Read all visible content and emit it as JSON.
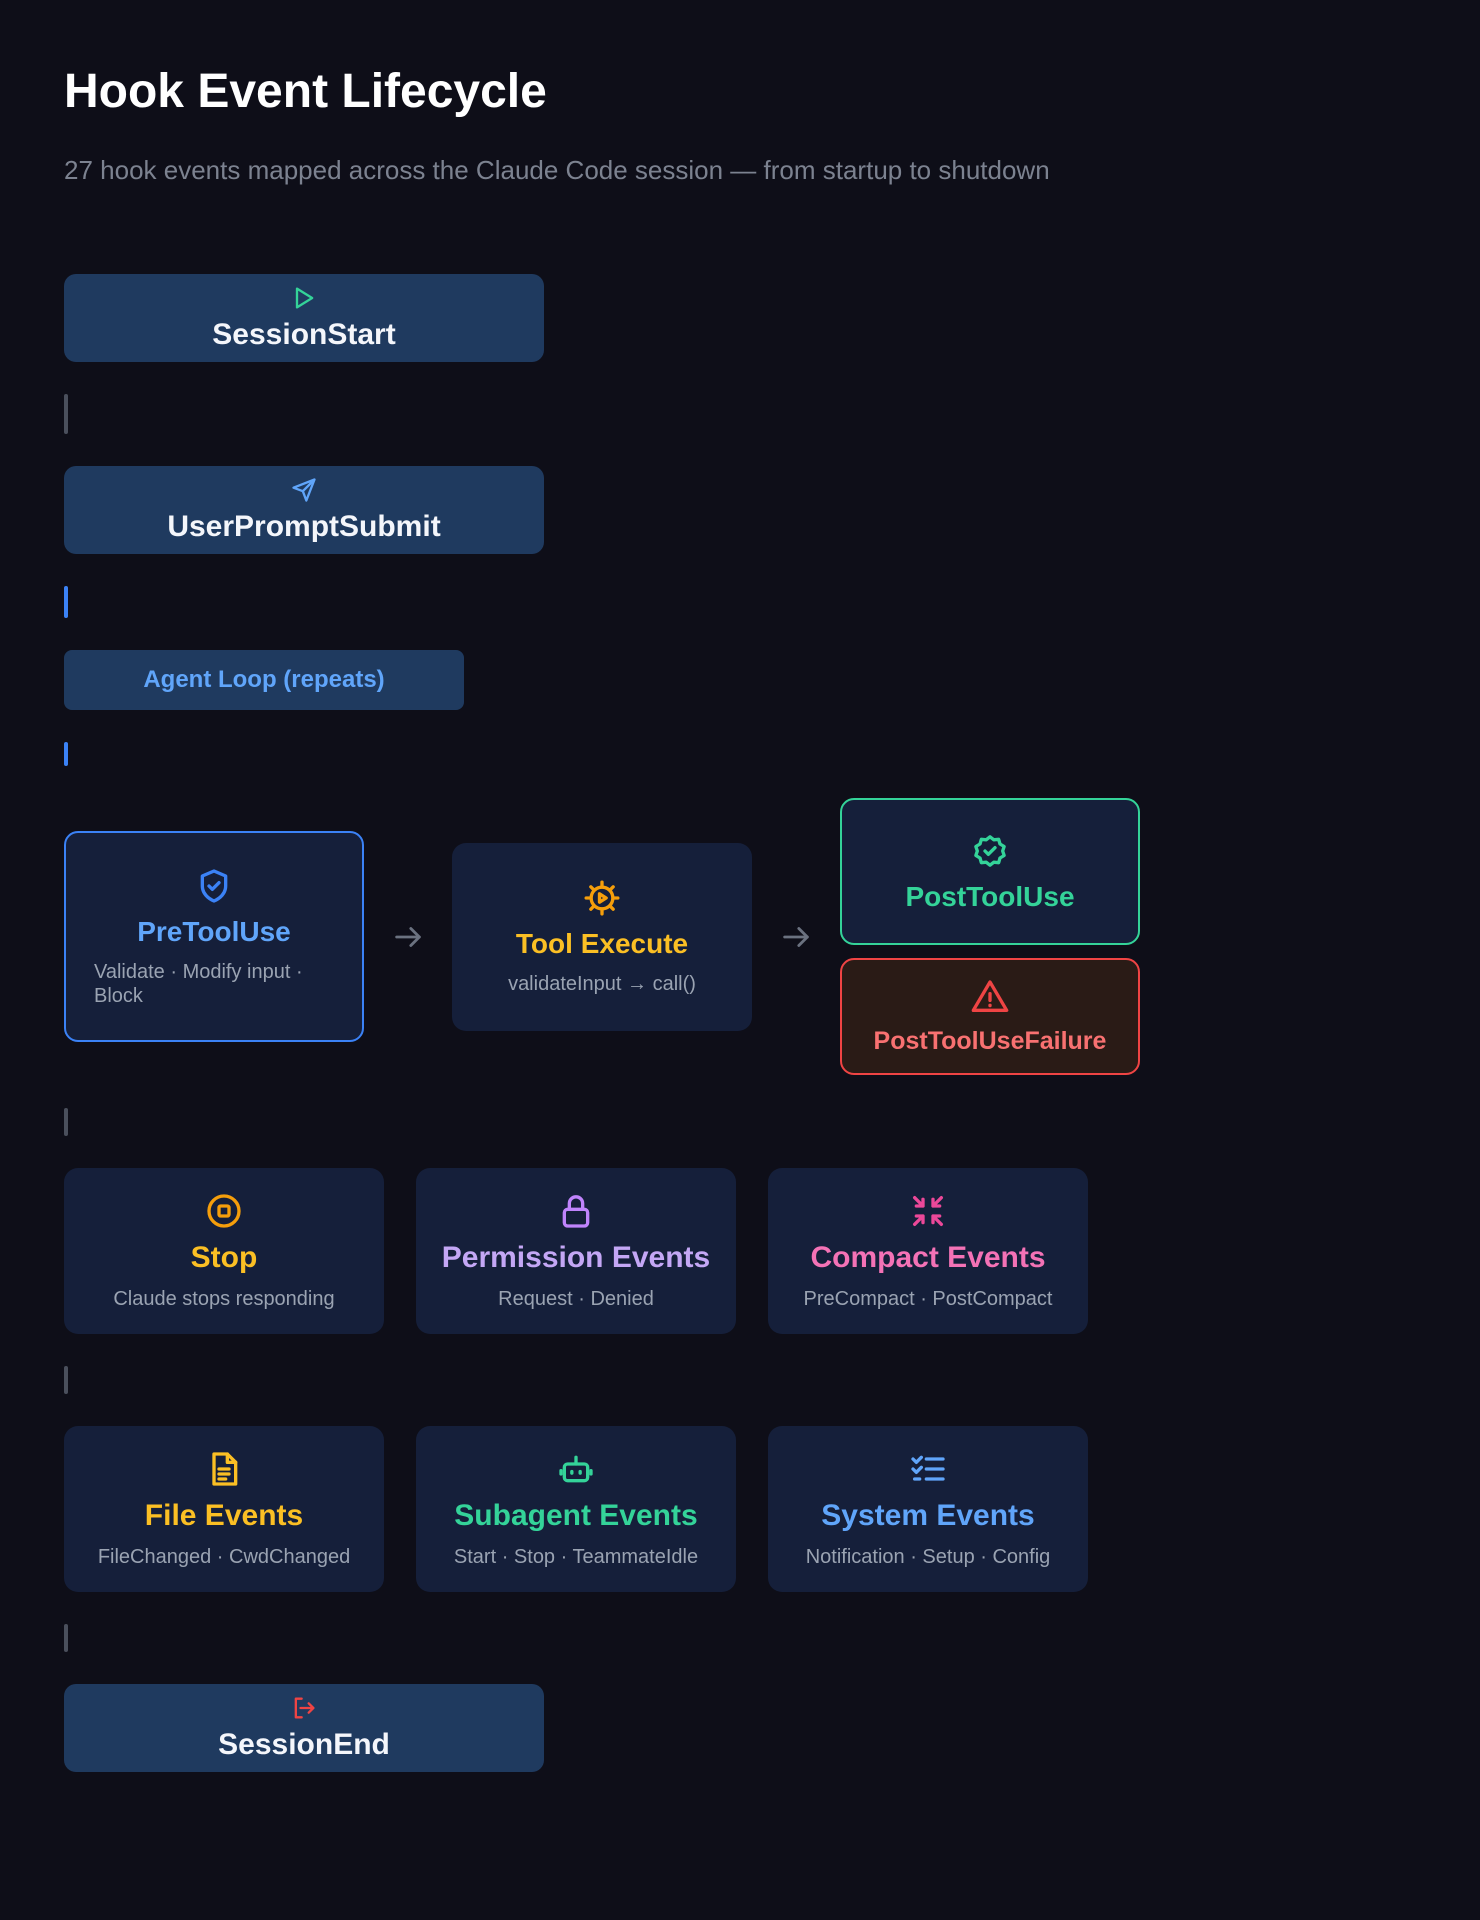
{
  "header": {
    "title": "Hook Event Lifecycle",
    "subtitle": "27 hook events mapped across the Claude Code session — from startup to shutdown"
  },
  "session_start": {
    "label": "SessionStart",
    "icon": "play-icon"
  },
  "user_prompt_submit": {
    "label": "UserPromptSubmit",
    "icon": "send-icon"
  },
  "agent_loop": {
    "label": "Agent Loop (repeats)"
  },
  "tool_flow": {
    "pre_tool_use": {
      "title": "PreToolUse",
      "desc": "Validate · Modify input · Block",
      "icon": "shield-check-icon"
    },
    "tool_execute": {
      "title": "Tool Execute",
      "desc": "validateInput → call()",
      "icon": "gear-play-icon"
    },
    "post_tool_use": {
      "title": "PostToolUse",
      "icon": "badge-check-icon"
    },
    "post_tool_use_failure": {
      "title": "PostToolUseFailure",
      "icon": "warning-icon"
    }
  },
  "event_groups_1": [
    {
      "title": "Stop",
      "desc": "Claude stops responding",
      "icon": "stop-circle-icon",
      "color": "#fbbf24"
    },
    {
      "title": "Permission Events",
      "desc": "Request · Denied",
      "icon": "lock-icon",
      "color": "#c4a7f5"
    },
    {
      "title": "Compact Events",
      "desc": "PreCompact · PostCompact",
      "icon": "compress-icon",
      "color": "#f472b6"
    }
  ],
  "event_groups_2": [
    {
      "title": "File Events",
      "desc": "FileChanged · CwdChanged",
      "icon": "file-icon",
      "color": "#fbbf24"
    },
    {
      "title": "Subagent Events",
      "desc": "Start · Stop · TeammateIdle",
      "icon": "bot-icon",
      "color": "#34d399"
    },
    {
      "title": "System Events",
      "desc": "Notification · Setup · Config",
      "icon": "checklist-icon",
      "color": "#60a5fa"
    }
  ],
  "session_end": {
    "label": "SessionEnd",
    "icon": "logout-icon"
  },
  "colors": {
    "background": "#0e0e18",
    "phase": "#1f3a5f",
    "card": "#151f3a",
    "blue": "#3b82f6",
    "green": "#34d399",
    "red": "#ef4444",
    "amber": "#fbbf24"
  }
}
